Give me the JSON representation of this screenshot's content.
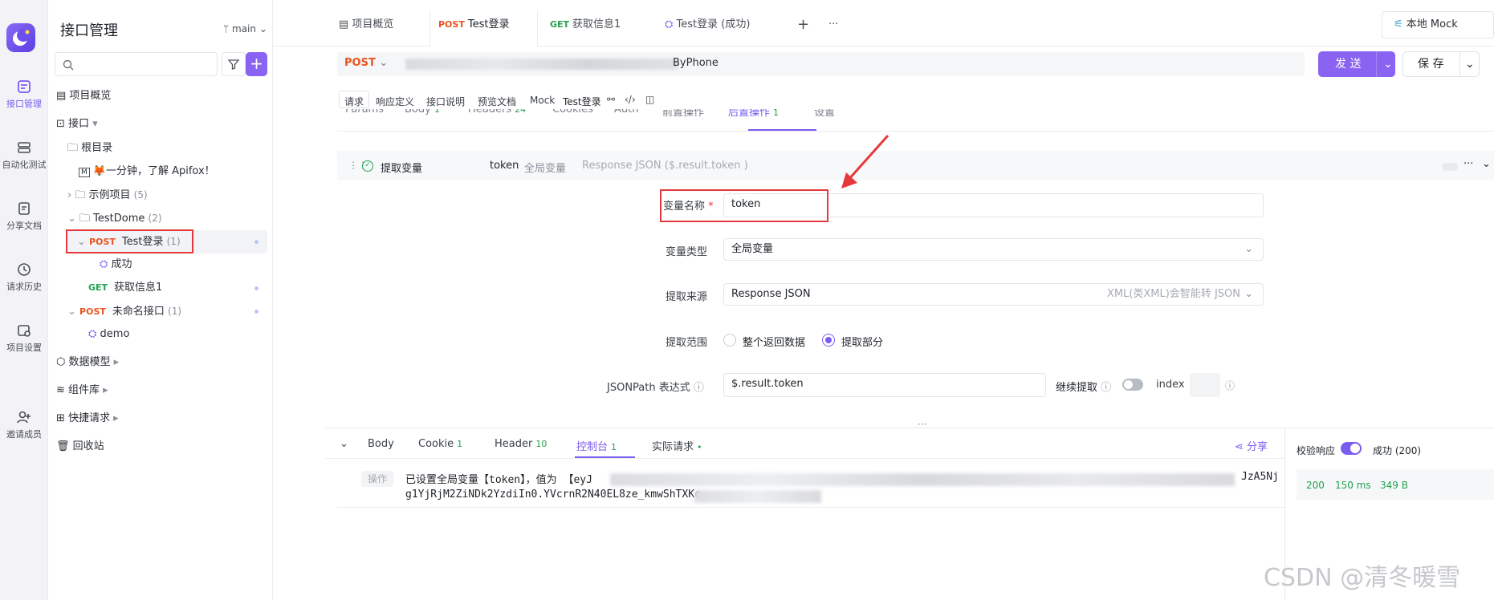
{
  "rail": {
    "items": [
      {
        "label": "接口管理"
      },
      {
        "label": "自动化测试"
      },
      {
        "label": "分享文档"
      },
      {
        "label": "请求历史"
      },
      {
        "label": "项目设置"
      },
      {
        "label": "邀请成员"
      }
    ]
  },
  "tree": {
    "title": "接口管理",
    "branch": "main",
    "overview": "项目概览",
    "interfaces": "接口",
    "root": "根目录",
    "intro": "一分钟，了解 Apifox！",
    "examples": "示例项目",
    "examples_count": "(5)",
    "folder": "TestDome",
    "folder_count": "(2)",
    "post_method": "POST",
    "get_method": "GET",
    "login": "Test登录",
    "login_count": "(1)",
    "success": "成功",
    "getinfo": "获取信息1",
    "unnamed": "未命名接口",
    "unnamed_count": "(1)",
    "demo": "demo",
    "models": "数据模型",
    "components": "组件库",
    "quick": "快捷请求",
    "trash": "回收站"
  },
  "tabs": {
    "overview": "项目概览",
    "t1_method": "POST",
    "t1_label": "Test登录",
    "t2_method": "GET",
    "t2_label": "获取信息1",
    "t3_label": "Test登录 (成功)",
    "add": "+",
    "more": "···",
    "env": "本地 Mock"
  },
  "request": {
    "method": "POST",
    "url_tail": "ByPhone",
    "send": "发 送",
    "save": "保 存"
  },
  "subtabs": [
    "请求",
    "响应定义",
    "接口说明",
    "预览文档",
    "Mock",
    "Test登录"
  ],
  "params_tabs": [
    {
      "label": "Params"
    },
    {
      "label": "Body",
      "badge": "1"
    },
    {
      "label": "Headers",
      "badge": "24"
    },
    {
      "label": "Cookies"
    },
    {
      "label": "Auth"
    },
    {
      "label": "前置操作"
    },
    {
      "label": "后置操作",
      "badge": "1"
    },
    {
      "label": "设置"
    }
  ],
  "extract": {
    "title": "提取变量",
    "var_name": "token",
    "scope": "全局变量",
    "summary": "Response JSON ($.result.token )"
  },
  "form": {
    "name_label": "变量名称",
    "required": "*",
    "name_value": "token",
    "type_label": "变量类型",
    "type_value": "全局变量",
    "source_label": "提取来源",
    "source_value": "Response JSON",
    "source_hint": "XML(类XML)会智能转 JSON",
    "range_label": "提取范围",
    "range_opt1": "整个返回数据",
    "range_opt2": "提取部分",
    "jsonpath_label": "JSONPath 表达式",
    "jsonpath_value": "$.result.token",
    "continue_label": "继续提取",
    "index_label": "index"
  },
  "bottom": {
    "tabs": [
      {
        "label": "Body"
      },
      {
        "label": "Cookie",
        "badge": "1"
      },
      {
        "label": "Header",
        "badge": "10"
      },
      {
        "label": "控制台",
        "badge": "1"
      },
      {
        "label": "实际请求",
        "badge": "•"
      }
    ],
    "share": "分享",
    "op_tag": "操作",
    "log_line1": "已设置全局变量【token】，值为 【eyJ",
    "log_line1_end": "JzA5Nj",
    "log_line2": "g1YjRjM2ZiNDk2YzdiIn0.YVcrnR2N40EL8ze_kmwShTXKc"
  },
  "response_side": {
    "validate": "校验响应",
    "result": "成功 (200)",
    "status": "200",
    "time": "150 ms",
    "size": "349 B"
  },
  "watermark": "CSDN @清冬暖雪",
  "colors": {
    "accent": "#7a5cf0",
    "post": "#e8541e",
    "get": "#23a14f",
    "annotation": "#e5393b"
  }
}
